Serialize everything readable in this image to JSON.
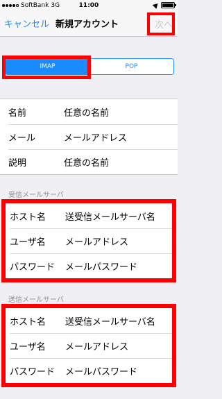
{
  "status_bar": {
    "carrier": "SoftBank",
    "network": "3G",
    "time": "11:00"
  },
  "nav": {
    "cancel": "キャンセル",
    "title": "新規アカウント",
    "next": "次へ"
  },
  "segmented": {
    "options": [
      "IMAP",
      "POP"
    ],
    "selected": "IMAP"
  },
  "account": {
    "rows": [
      {
        "label": "名前",
        "value": "任意の名前"
      },
      {
        "label": "メール",
        "value": "メールアドレス"
      },
      {
        "label": "説明",
        "value": "任意の名前"
      }
    ]
  },
  "incoming": {
    "title": "受信メールサーバ",
    "rows": [
      {
        "label": "ホスト名",
        "value": "送受信メールサーバ名"
      },
      {
        "label": "ユーザ名",
        "value": "メールアドレス"
      },
      {
        "label": "パスワード",
        "value": "メールパスワード"
      }
    ]
  },
  "outgoing": {
    "title": "送信メールサーバ",
    "rows": [
      {
        "label": "ホスト名",
        "value": "送受信メールサーバ名"
      },
      {
        "label": "ユーザ名",
        "value": "メールアドレス"
      },
      {
        "label": "パスワード",
        "value": "メールパスワード"
      }
    ]
  },
  "colors": {
    "accent": "#1a8cff",
    "highlight": "#ff0000"
  }
}
